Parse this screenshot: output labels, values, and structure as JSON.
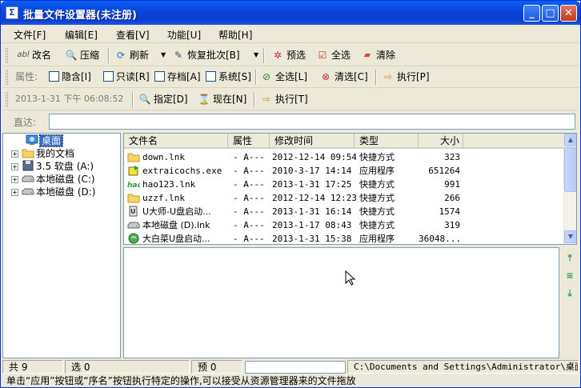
{
  "window": {
    "title": "批量文件设置器(未注册)",
    "min": "_",
    "max": "□",
    "close": "✕"
  },
  "menu": [
    "文件[F]",
    "编辑[E]",
    "查看[V]",
    "功能[U]",
    "帮助[H]"
  ],
  "toolbar1": {
    "rename": "改名",
    "compress": "压缩",
    "refresh": "刷新",
    "restore": "恢复批次[B]",
    "preselect": "预选",
    "select_all": "全选",
    "clear": "清除"
  },
  "toolbar2": {
    "label": "属性:",
    "hidden": "隐含[I]",
    "readonly": "只读[R]",
    "archive": "存档[A]",
    "system": "系统[S]",
    "select_all": "全选[L]",
    "clear_sel": "清选[C]",
    "execute": "执行[P]"
  },
  "toolbar3": {
    "datetime": "2013-1-31  下午 06:08:52",
    "specify": "指定[D]",
    "now": "现在[N]",
    "execute": "执行[T]"
  },
  "address": {
    "label": "直达:",
    "value": ""
  },
  "tree": [
    {
      "label": "桌面",
      "icon": "desktop-icon",
      "selected": true
    },
    {
      "label": "我的文档",
      "icon": "folder-icon"
    },
    {
      "label": "3.5 软盘 (A:)",
      "icon": "floppy-icon"
    },
    {
      "label": "本地磁盘 (C:)",
      "icon": "drive-icon"
    },
    {
      "label": "本地磁盘 (D:)",
      "icon": "drive-icon"
    }
  ],
  "columns": {
    "name": "文件名",
    "attr": "属性",
    "mtime": "修改时间",
    "type": "类型",
    "size": "大小"
  },
  "files": [
    {
      "name": "down.lnk",
      "attr": "- A---",
      "mtime": "2012-12-14 09:54",
      "type": "快捷方式",
      "size": "323",
      "icon": "folder-icon"
    },
    {
      "name": "extraicochs.exe",
      "attr": "- A---",
      "mtime": "2010-3-17 14:14",
      "type": "应用程序",
      "size": "651264",
      "icon": "exe-icon"
    },
    {
      "name": "hao123.lnk",
      "attr": "- A---",
      "mtime": "2013-1-31 17:25",
      "type": "快捷方式",
      "size": "991",
      "icon": "hao-icon"
    },
    {
      "name": "uzzf.lnk",
      "attr": "- A---",
      "mtime": "2012-12-14 12:23",
      "type": "快捷方式",
      "size": "266",
      "icon": "folder-icon"
    },
    {
      "name": "U大师-U盘启动...",
      "attr": "- A---",
      "mtime": "2013-1-31 16:14",
      "type": "快捷方式",
      "size": "1574",
      "icon": "usb-icon"
    },
    {
      "name": "本地磁盘 (D).lnk",
      "attr": "- A---",
      "mtime": "2013-1-17 08:43",
      "type": "快捷方式",
      "size": "319",
      "icon": "drive-icon"
    },
    {
      "name": "大白菜U盘启动...",
      "attr": "- A---",
      "mtime": "2013-1-31 15:38",
      "type": "应用程序",
      "size": "36048...",
      "icon": "cabbage-icon"
    }
  ],
  "status": {
    "total": "共 9",
    "selected": "选 0",
    "pre": "预 0",
    "path": "C:\\Documents and Settings\\Administrator\\桌面"
  },
  "hint": "单击“应用”按钮或“序名”按钮执行特定的操作,可以接受从资源管理器来的文件拖放",
  "colors": {
    "titlebar": "#0a4fe6",
    "selection": "#316ac5",
    "face": "#ece9d8",
    "accent_green": "#2ea043"
  }
}
